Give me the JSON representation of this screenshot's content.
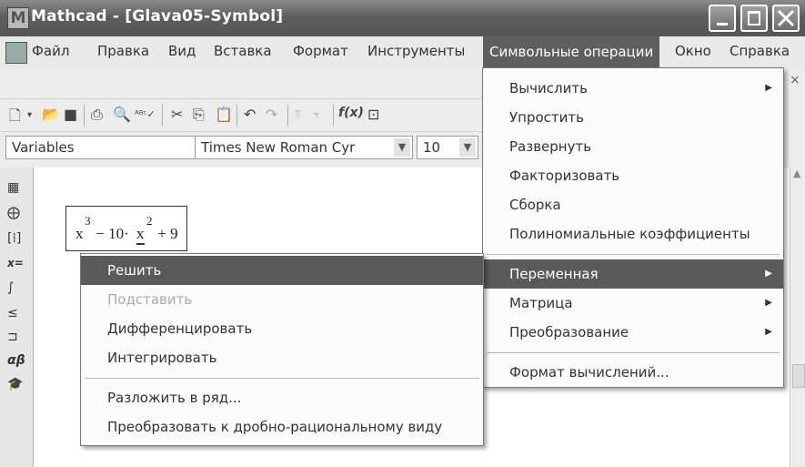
{
  "window": {
    "app_name": "Mathcad",
    "title": "Mathcad - [Glava05-Symbol]",
    "icon": "mathcad-logo-icon"
  },
  "menubar": {
    "items": [
      "Файл",
      "Правка",
      "Вид",
      "Вставка",
      "Формат",
      "Инструменты",
      "Символьные операции",
      "Окно",
      "Справка"
    ],
    "active": "Символьные операции"
  },
  "format_bar": {
    "style": "Variables",
    "font": "Times New Roman Cyr",
    "size": "10"
  },
  "formula": {
    "base": "x",
    "exp1": "3",
    "middle": " − 10·",
    "base2": "x",
    "exp2": "2",
    "tail": " + 9"
  },
  "symbolic_menu": {
    "items": [
      {
        "label": "Вычислить",
        "submenu": true
      },
      {
        "label": "Упростить"
      },
      {
        "label": "Развернуть"
      },
      {
        "label": "Факторизовать"
      },
      {
        "label": "Сборка"
      },
      {
        "label": "Полиномиальные коэффициенты"
      },
      {
        "label": "Переменная",
        "submenu": true,
        "highlighted": true
      },
      {
        "label": "Матрица",
        "submenu": true
      },
      {
        "label": "Преобразование",
        "submenu": true
      },
      {
        "label": "Формат вычислений..."
      }
    ]
  },
  "variable_submenu": {
    "items": [
      {
        "label": "Решить",
        "highlighted": true
      },
      {
        "label": "Подставить",
        "disabled": true
      },
      {
        "label": "Дифференцировать"
      },
      {
        "label": "Интегрировать"
      },
      {
        "label": "Разложить в ряд..."
      },
      {
        "label": "Преобразовать к дробно-рациональному виду"
      }
    ]
  },
  "colors": {
    "titlebar": "#5e5e5e",
    "menu_highlight": "#5a5a5a"
  }
}
